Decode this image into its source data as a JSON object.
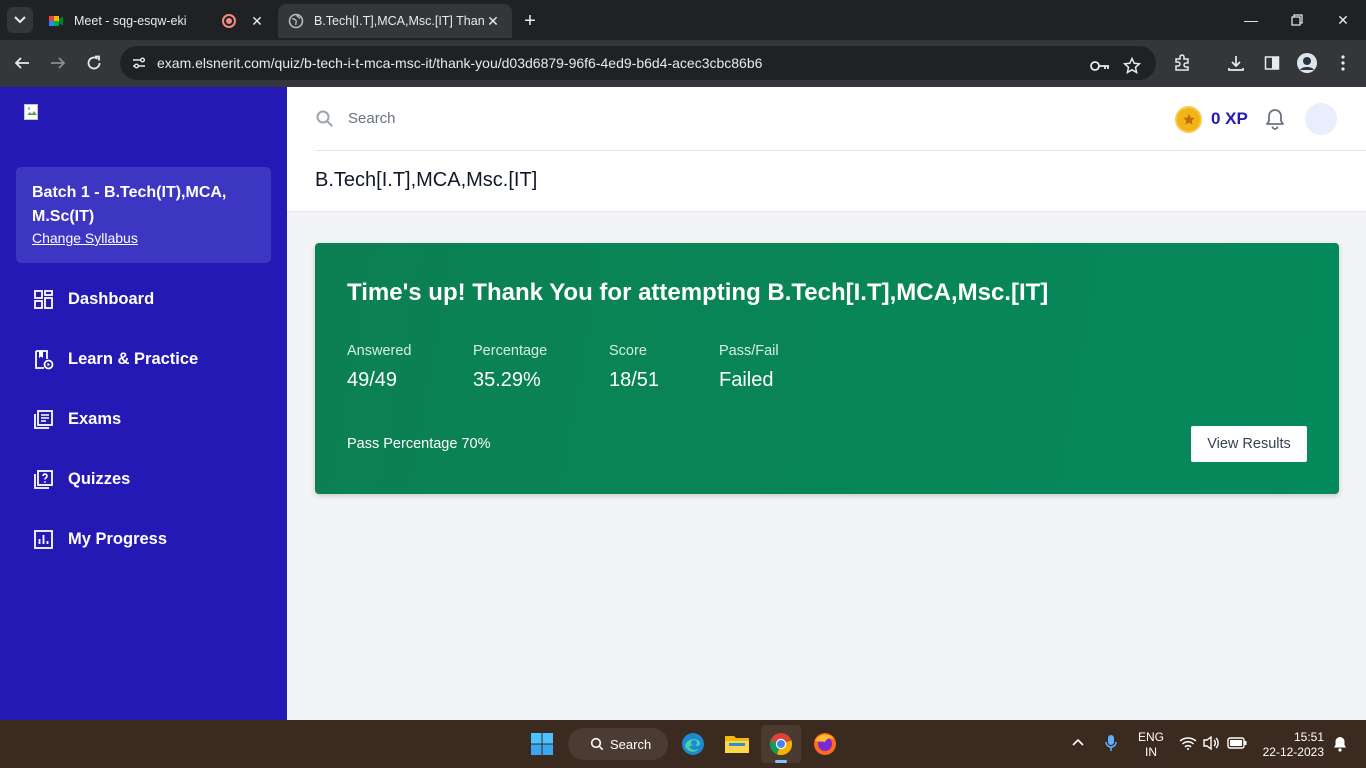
{
  "browser": {
    "tabs": [
      {
        "title": "Meet - sqg-esqw-eki",
        "active": false
      },
      {
        "title": "B.Tech[I.T],MCA,Msc.[IT] Thank You",
        "active": true
      }
    ],
    "url": "exam.elsnerit.com/quiz/b-tech-i-t-mca-msc-it/thank-you/d03d6879-96f6-4ed9-b6d4-acec3cbc86b6"
  },
  "sidebar": {
    "batch": "Batch 1 - B.Tech(IT),MCA, M.Sc(IT)",
    "change_syllabus": "Change Syllabus",
    "items": [
      {
        "label": "Dashboard",
        "icon": "dashboard-icon"
      },
      {
        "label": "Learn & Practice",
        "icon": "learn-icon"
      },
      {
        "label": "Exams",
        "icon": "exams-icon"
      },
      {
        "label": "Quizzes",
        "icon": "quizzes-icon"
      },
      {
        "label": "My Progress",
        "icon": "progress-icon"
      }
    ]
  },
  "header": {
    "search_placeholder": "Search",
    "xp": "0 XP",
    "page_title": "B.Tech[I.T],MCA,Msc.[IT]"
  },
  "result": {
    "headline": "Time's up! Thank You for attempting B.Tech[I.T],MCA,Msc.[IT]",
    "stats": [
      {
        "label": "Answered",
        "value": "49/49"
      },
      {
        "label": "Percentage",
        "value": "35.29%"
      },
      {
        "label": "Score",
        "value": "18/51"
      },
      {
        "label": "Pass/Fail",
        "value": "Failed"
      }
    ],
    "pass_percentage": "Pass Percentage 70%",
    "view_results": "View Results"
  },
  "taskbar": {
    "search": "Search",
    "lang_line1": "ENG",
    "lang_line2": "IN",
    "time": "15:51",
    "date": "22-12-2023"
  },
  "colors": {
    "sidebar": "#2419b5",
    "card": "#058a5c",
    "xp_text": "#2419b5"
  }
}
